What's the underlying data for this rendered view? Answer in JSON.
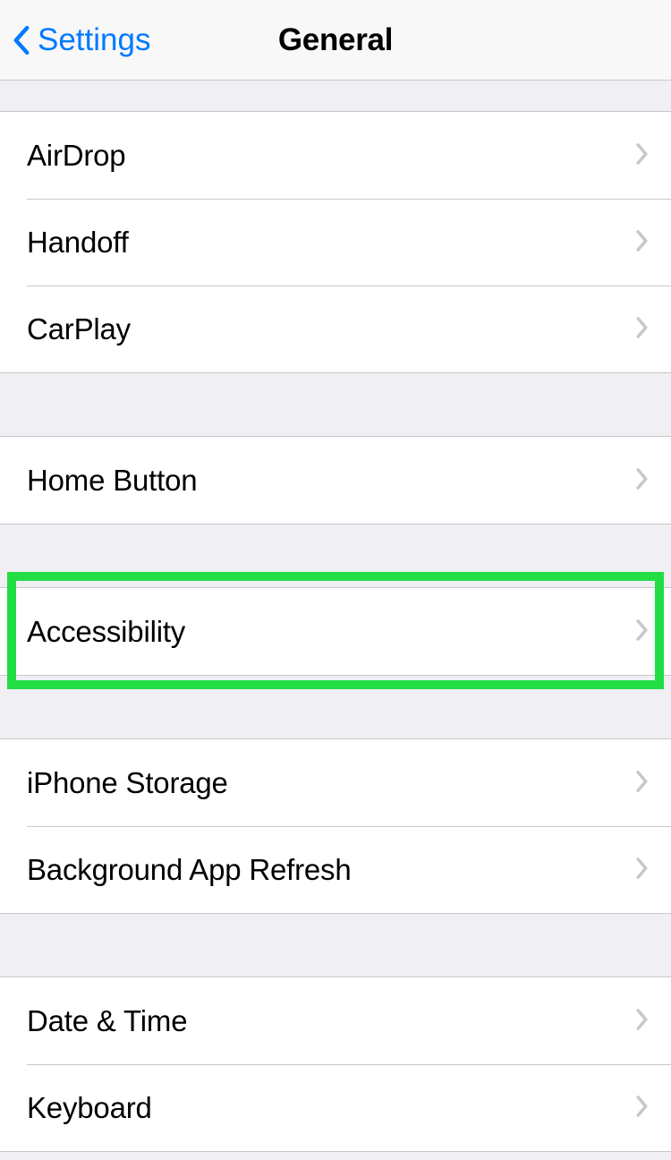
{
  "nav": {
    "back_label": "Settings",
    "title": "General"
  },
  "groups": [
    {
      "gap_before": "small",
      "items": [
        {
          "id": "airdrop",
          "label": "AirDrop"
        },
        {
          "id": "handoff",
          "label": "Handoff"
        },
        {
          "id": "carplay",
          "label": "CarPlay"
        }
      ]
    },
    {
      "gap_before": "large",
      "items": [
        {
          "id": "home-button",
          "label": "Home Button"
        }
      ]
    },
    {
      "gap_before": "large",
      "items": [
        {
          "id": "accessibility",
          "label": "Accessibility",
          "highlighted": true
        }
      ]
    },
    {
      "gap_before": "large",
      "items": [
        {
          "id": "iphone-storage",
          "label": "iPhone Storage"
        },
        {
          "id": "background-app-refresh",
          "label": "Background App Refresh"
        }
      ]
    },
    {
      "gap_before": "large",
      "items": [
        {
          "id": "date-time",
          "label": "Date & Time"
        },
        {
          "id": "keyboard",
          "label": "Keyboard"
        }
      ]
    }
  ],
  "highlight": {
    "color": "#22dd44",
    "target_id": "accessibility"
  }
}
